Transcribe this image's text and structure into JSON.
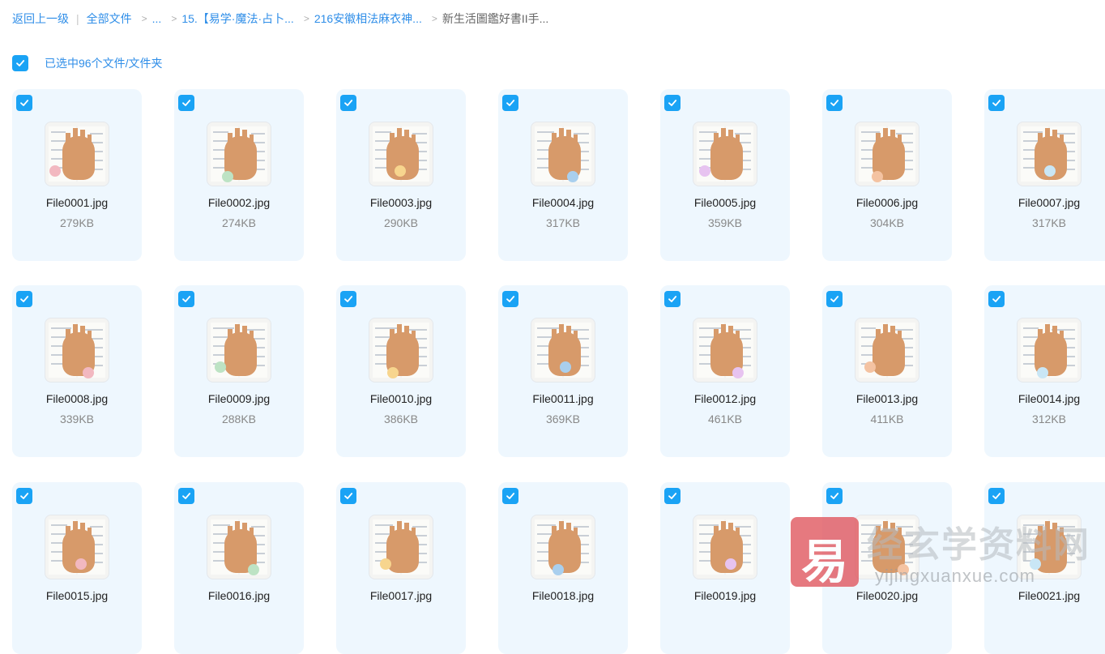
{
  "breadcrumb": {
    "back": "返回上一级",
    "items": [
      "全部文件",
      "...",
      "15.【易学·魔法·占卜...",
      "216安徽相法麻衣神...",
      "新生活圖鑑好書II手..."
    ]
  },
  "selection": {
    "label": "已选中96个文件/文件夹",
    "checked": true
  },
  "files": [
    {
      "name": "File0001.jpg",
      "size": "279KB"
    },
    {
      "name": "File0002.jpg",
      "size": "274KB"
    },
    {
      "name": "File0003.jpg",
      "size": "290KB"
    },
    {
      "name": "File0004.jpg",
      "size": "317KB"
    },
    {
      "name": "File0005.jpg",
      "size": "359KB"
    },
    {
      "name": "File0006.jpg",
      "size": "304KB"
    },
    {
      "name": "File0007.jpg",
      "size": "317KB"
    },
    {
      "name": "File0008.jpg",
      "size": "339KB"
    },
    {
      "name": "File0009.jpg",
      "size": "288KB"
    },
    {
      "name": "File0010.jpg",
      "size": "386KB"
    },
    {
      "name": "File0011.jpg",
      "size": "369KB"
    },
    {
      "name": "File0012.jpg",
      "size": "461KB"
    },
    {
      "name": "File0013.jpg",
      "size": "411KB"
    },
    {
      "name": "File0014.jpg",
      "size": "312KB"
    },
    {
      "name": "File0015.jpg",
      "size": ""
    },
    {
      "name": "File0016.jpg",
      "size": ""
    },
    {
      "name": "File0017.jpg",
      "size": ""
    },
    {
      "name": "File0018.jpg",
      "size": ""
    },
    {
      "name": "File0019.jpg",
      "size": ""
    },
    {
      "name": "File0020.jpg",
      "size": ""
    },
    {
      "name": "File0021.jpg",
      "size": ""
    }
  ],
  "watermark": {
    "logo_char": "易",
    "title": "经玄学资料网",
    "url": "yijingxuanxue.com"
  },
  "colors": {
    "accent": "#1aa3f5",
    "link": "#2f8ee8",
    "card_bg": "#eef7fe"
  },
  "icons": {
    "checkbox": "checkmark-icon",
    "crumb_separator": "chevron-right-icon"
  }
}
